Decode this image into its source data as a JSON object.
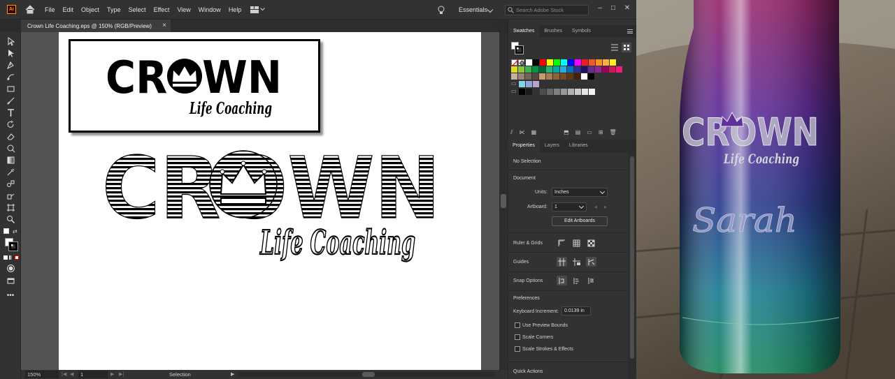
{
  "app": {
    "logo_text": "Ai"
  },
  "menu": [
    "File",
    "Edit",
    "Object",
    "Type",
    "Select",
    "Effect",
    "View",
    "Window",
    "Help"
  ],
  "workspace": {
    "label": "Essentials"
  },
  "search": {
    "placeholder": "Search Adobe Stock"
  },
  "document_tab": {
    "title": "Crown Life Coaching.eps @ 150% (RGB/Preview)",
    "close": "×"
  },
  "artwork": {
    "logo_word": "CROWN",
    "logo_tagline": "Life Coaching",
    "main_word": "CROWN",
    "main_tagline": "Life Coaching"
  },
  "statusbar": {
    "zoom": "150%",
    "artboard": "1",
    "mode": "Selection"
  },
  "swatches_panel": {
    "tabs": [
      "Swatches",
      "Brushes",
      "Symbols"
    ],
    "active_tab": "Swatches",
    "row1": [
      "#ffffff",
      "#000000",
      "#ff0000",
      "#ffff00",
      "#00ff00",
      "#00ffff",
      "#0000ff",
      "#ff00ff",
      "#ed1c24",
      "#f15a24",
      "#f7931e",
      "#fbb03b",
      "#fcee21"
    ],
    "row2": [
      "#d9e021",
      "#8cc63f",
      "#39b54a",
      "#009245",
      "#006837",
      "#22b573",
      "#00a99d",
      "#29abe2",
      "#0071bc",
      "#2e3192",
      "#1b1464",
      "#662d91",
      "#93278f",
      "#9e005d",
      "#d4145a",
      "#ed1e79"
    ],
    "row3": [
      "#c7b299",
      "#998675",
      "#736357",
      "#534741",
      "#c69c6d",
      "#a67c52",
      "#8c6239",
      "#754c24",
      "#603813",
      "#42210b",
      "#ffffff",
      "#000000"
    ],
    "row4": [
      "#7fd4e8",
      "#8fa8d8",
      "#b8a2cf"
    ],
    "row5": [
      "#000000",
      "#1a1a1a",
      "#333333",
      "#4d4d4d",
      "#666666",
      "#808080",
      "#999999",
      "#b3b3b3",
      "#cccccc",
      "#e6e6e6",
      "#f2f2f2"
    ]
  },
  "properties_panel": {
    "tabs": [
      "Properties",
      "Layers",
      "Libraries"
    ],
    "active_tab": "Properties",
    "selection": "No Selection",
    "document_title": "Document",
    "units_label": "Units:",
    "units_value": "Inches",
    "artboard_label": "Artboard:",
    "artboard_value": "1",
    "edit_artboards": "Edit Artboards",
    "rulers_label": "Ruler & Grids",
    "guides_label": "Guides",
    "snap_label": "Snap Options",
    "preferences_title": "Preferences",
    "keyboard_increment_label": "Keyboard Increment:",
    "keyboard_increment_value": "0.0139 in",
    "checkboxes": [
      "Use Preview Bounds",
      "Scale Corners",
      "Scale Strokes & Effects"
    ],
    "quick_actions": "Quick Actions"
  },
  "photo": {
    "engraved_word": "CROWN",
    "engraved_tagline": "Life Coaching",
    "engraved_name": "Sarah"
  }
}
